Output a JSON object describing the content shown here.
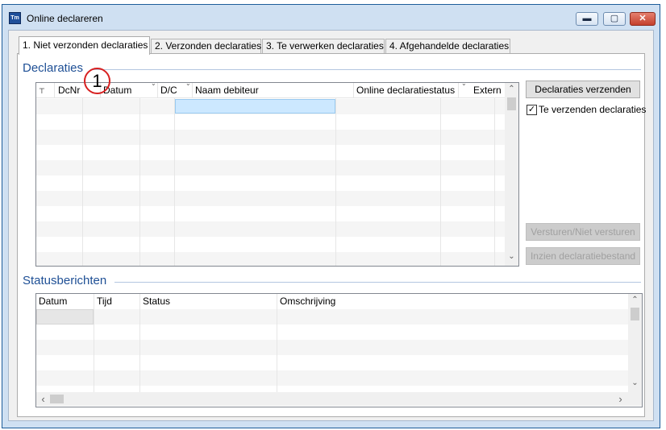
{
  "window": {
    "title": "Online declareren",
    "app_icon_text": "Tm",
    "controls": {
      "minimize": "▬",
      "maximize": "▢",
      "close": "✕"
    }
  },
  "tabs": [
    {
      "label": "1. Niet verzonden declaraties",
      "active": true
    },
    {
      "label": "2. Verzonden declaraties",
      "active": false
    },
    {
      "label": "3. Te verwerken declaraties",
      "active": false
    },
    {
      "label": "4. Afgehandelde declaraties",
      "active": false
    }
  ],
  "declaraties": {
    "section_title": "Declaraties",
    "columns": [
      "",
      "DcNr",
      "Datum",
      "D/C",
      "Naam debiteur",
      "Online declaratiestatus",
      "Extern ..."
    ],
    "first_col_icon": "filter-icon",
    "rows": []
  },
  "callout": {
    "label": "1"
  },
  "buttons": {
    "send": "Declaraties verzenden",
    "toggle_send": "Versturen/Niet versturen",
    "view_file": "Inzien declaratiebestand"
  },
  "checkbox": {
    "label": "Te verzenden declaraties",
    "checked": true,
    "mark": "✓"
  },
  "statusberichten": {
    "section_title": "Statusberichten",
    "columns": [
      "Datum",
      "Tijd",
      "Status",
      "Omschrijving"
    ],
    "rows": []
  },
  "scroll_glyphs": {
    "up": "⌃",
    "down": "⌄",
    "left": "‹",
    "right": "›"
  },
  "colors": {
    "accent": "#1e4f95",
    "selection": "#cce8ff"
  }
}
